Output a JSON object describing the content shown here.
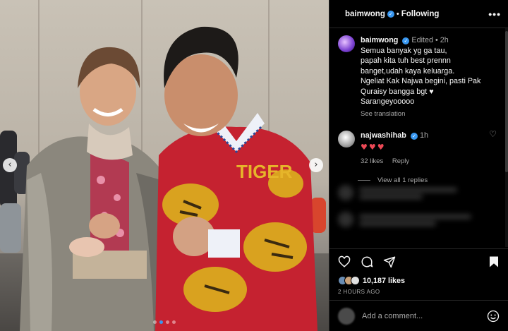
{
  "header": {
    "username": "baimwong",
    "separator": "•",
    "follow_status": "Following",
    "more": "•••"
  },
  "caption": {
    "username": "baimwong",
    "edited": "Edited",
    "dot": "•",
    "time": "2h",
    "lines": [
      "Semua banyak yg ga tau,",
      "papah kita tuh best prennn",
      "banget,udah kaya keluarga.",
      "Ngeliat Kak Najwa begini, pasti Pak",
      "Quraisy bangga bgt ♥",
      "Sarangeyooooo"
    ],
    "see_translation": "See translation"
  },
  "comment": {
    "username": "najwashihab",
    "time": "1h",
    "text": "♥♥♥",
    "likes": "32 likes",
    "reply": "Reply"
  },
  "view_replies": "View all 1 replies",
  "likes_count": "10,187 likes",
  "posted_ago": "2 HOURS AGO",
  "add_comment": {
    "placeholder": "Add a comment..."
  },
  "photo": {
    "prev_arrow": "‹",
    "next_arrow": "›",
    "shirt_text": "TIGER",
    "slide_count": 4,
    "active_slide": 1
  },
  "colors": {
    "accent": "#3897f0",
    "heart": "#ed4956",
    "muted": "#a8a8a8",
    "background": "#000000"
  },
  "icons": [
    "heart-icon",
    "comment-icon",
    "share-icon",
    "bookmark-icon",
    "emoji-icon",
    "verified-icon",
    "more-icon",
    "chevron-left-icon",
    "chevron-right-icon"
  ]
}
